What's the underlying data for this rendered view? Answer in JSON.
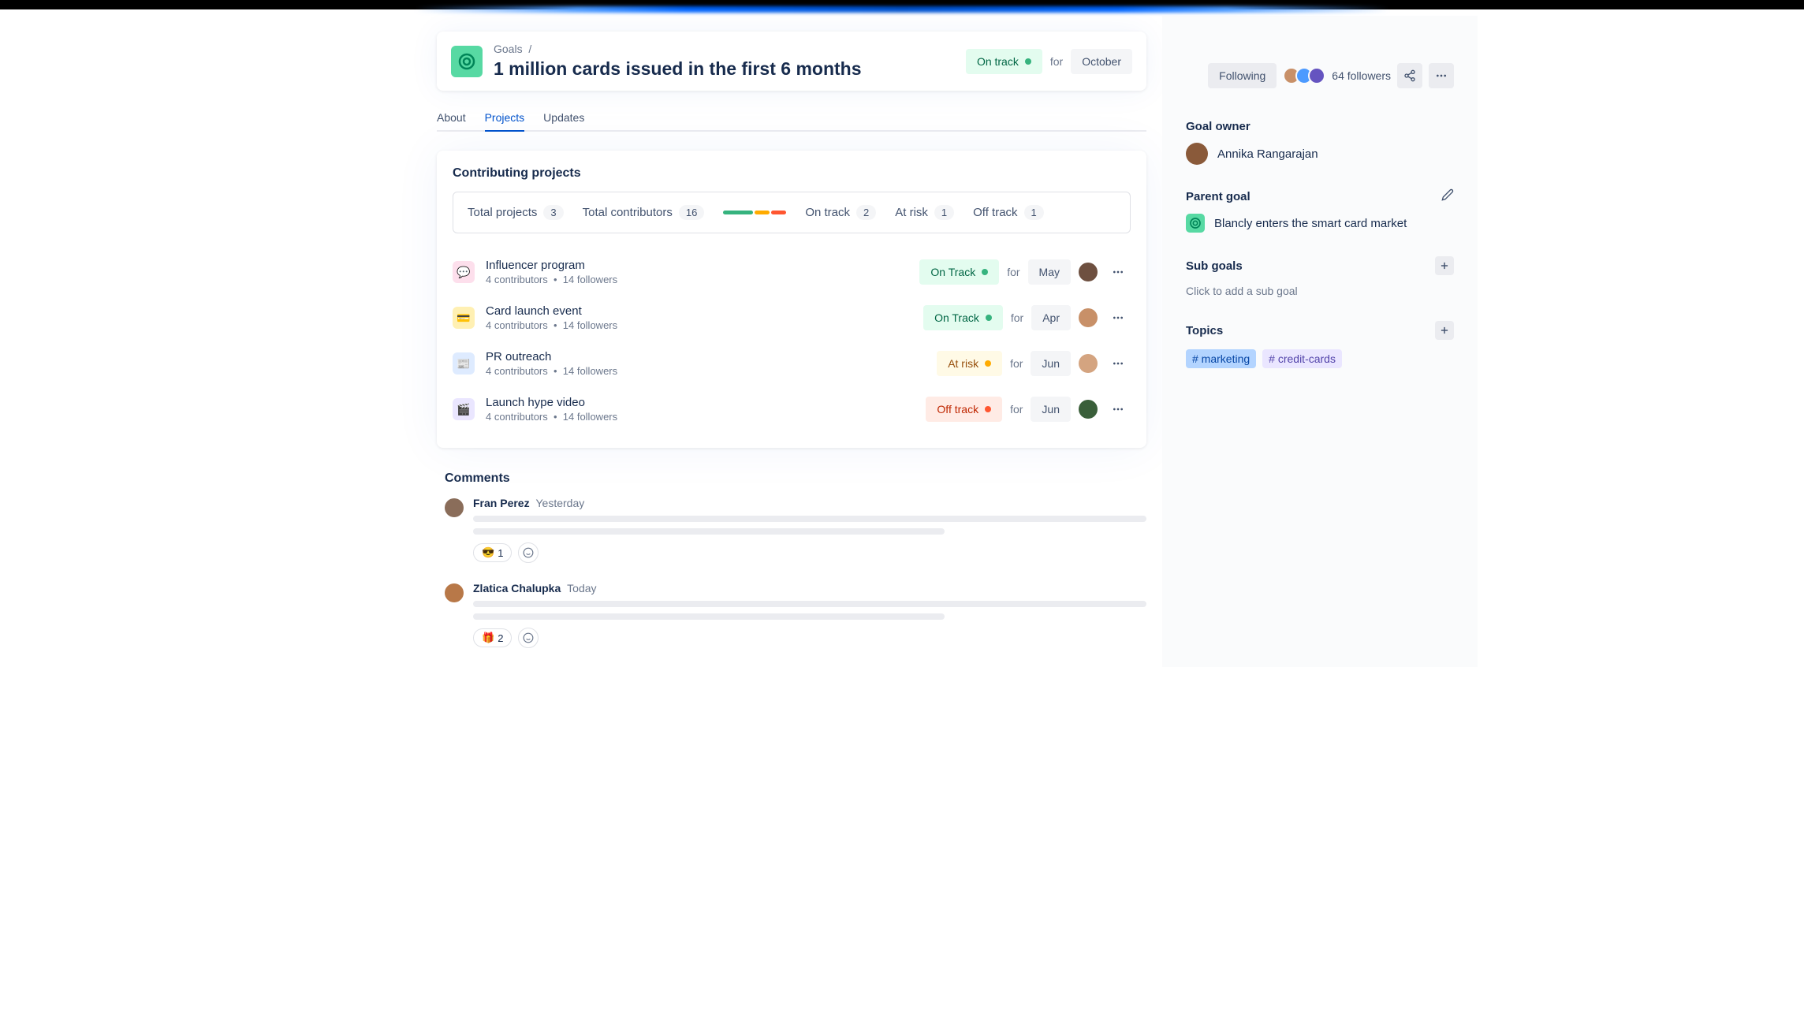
{
  "breadcrumb": {
    "parent": "Goals",
    "separator": "/"
  },
  "goal": {
    "title": "1 million cards issued in the first 6 months",
    "status": "On track",
    "for": "for",
    "month": "October"
  },
  "tabs": [
    "About",
    "Projects",
    "Updates"
  ],
  "activeTab": 1,
  "contributing": {
    "heading": "Contributing projects",
    "stats": {
      "totalProjectsLabel": "Total projects",
      "totalProjectsCount": "3",
      "totalContributorsLabel": "Total contributors",
      "totalContributorsCount": "16",
      "onTrackLabel": "On track",
      "onTrackCount": "2",
      "atRiskLabel": "At risk",
      "atRiskCount": "1",
      "offTrackLabel": "Off track",
      "offTrackCount": "1"
    },
    "projects": [
      {
        "icon": "💬",
        "iconBg": "#fddfec",
        "name": "Influencer program",
        "contributors": "4 contributors",
        "followers": "14 followers",
        "status": "On Track",
        "statusClass": "status-on-track",
        "dotClass": "dot-green",
        "for": "for",
        "month": "May",
        "avatarBg": "#6e5040"
      },
      {
        "icon": "💳",
        "iconBg": "#fff0b3",
        "name": "Card launch event",
        "contributors": "4 contributors",
        "followers": "14 followers",
        "status": "On Track",
        "statusClass": "status-on-track",
        "dotClass": "dot-green",
        "for": "for",
        "month": "Apr",
        "avatarBg": "#c89068"
      },
      {
        "icon": "📰",
        "iconBg": "#deebff",
        "name": "PR outreach",
        "contributors": "4 contributors",
        "followers": "14 followers",
        "status": "At risk",
        "statusClass": "status-at-risk",
        "dotClass": "dot-yellow",
        "for": "for",
        "month": "Jun",
        "avatarBg": "#d4a480"
      },
      {
        "icon": "🎬",
        "iconBg": "#eae6ff",
        "name": "Launch hype video",
        "contributors": "4 contributors",
        "followers": "14 followers",
        "status": "Off track",
        "statusClass": "status-off-track",
        "dotClass": "dot-red",
        "for": "for",
        "month": "Jun",
        "avatarBg": "#3a5f3a"
      }
    ]
  },
  "comments": {
    "heading": "Comments",
    "items": [
      {
        "author": "Fran Perez",
        "time": "Yesterday",
        "avatarBg": "#8a6d5a",
        "reaction": {
          "emoji": "😎",
          "count": "1"
        }
      },
      {
        "author": "Zlatica Chalupka",
        "time": "Today",
        "avatarBg": "#b87848",
        "reaction": {
          "emoji": "🎁",
          "count": "2"
        }
      }
    ]
  },
  "sidebar": {
    "following": "Following",
    "followersCount": "64 followers",
    "owner": {
      "label": "Goal owner",
      "name": "Annika Rangarajan",
      "avatarBg": "#8a5a3a"
    },
    "parentGoal": {
      "label": "Parent goal",
      "name": "Blancly enters the smart card market"
    },
    "subGoals": {
      "label": "Sub goals",
      "placeholder": "Click to add a sub goal"
    },
    "topics": {
      "label": "Topics",
      "items": [
        {
          "text": "# marketing",
          "bg": "#b3d4ff",
          "color": "#0747a6"
        },
        {
          "text": "# credit-cards",
          "bg": "#eae6ff",
          "color": "#5243aa"
        }
      ]
    }
  }
}
